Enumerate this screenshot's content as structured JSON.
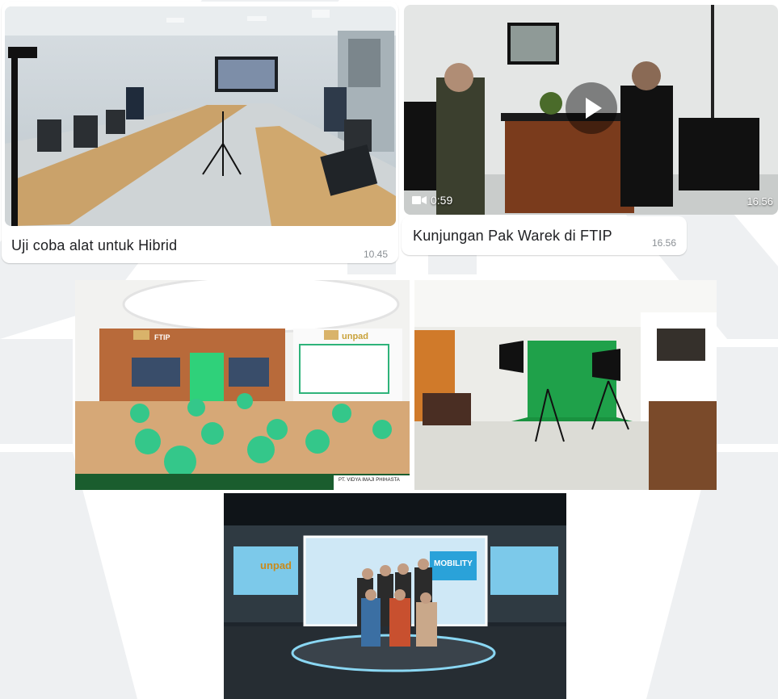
{
  "chat": {
    "messages": [
      {
        "caption": "Uji coba alat untuk Hibrid",
        "time": "10.45",
        "media": "photo"
      },
      {
        "caption": "Kunjungan Pak Warek di FTIP",
        "time": "16.56",
        "media": "video",
        "duration": "0:59",
        "overlay_time": "16.56"
      }
    ]
  },
  "gallery": {
    "vendor_label": "PT. VIDYA IMAJI PHIHASTA",
    "room_sign_ftip": "FTIP",
    "room_sign_unpad": "unpad",
    "studio_banner_unpad": "unpad",
    "studio_banner_mobility": "MOBILITY"
  },
  "icons": {
    "video": "video-camera-icon",
    "play": "play-icon"
  },
  "colors": {
    "bubble_bg": "#ffffff",
    "time": "#8a8f94",
    "accent_green": "#2fb37a"
  }
}
